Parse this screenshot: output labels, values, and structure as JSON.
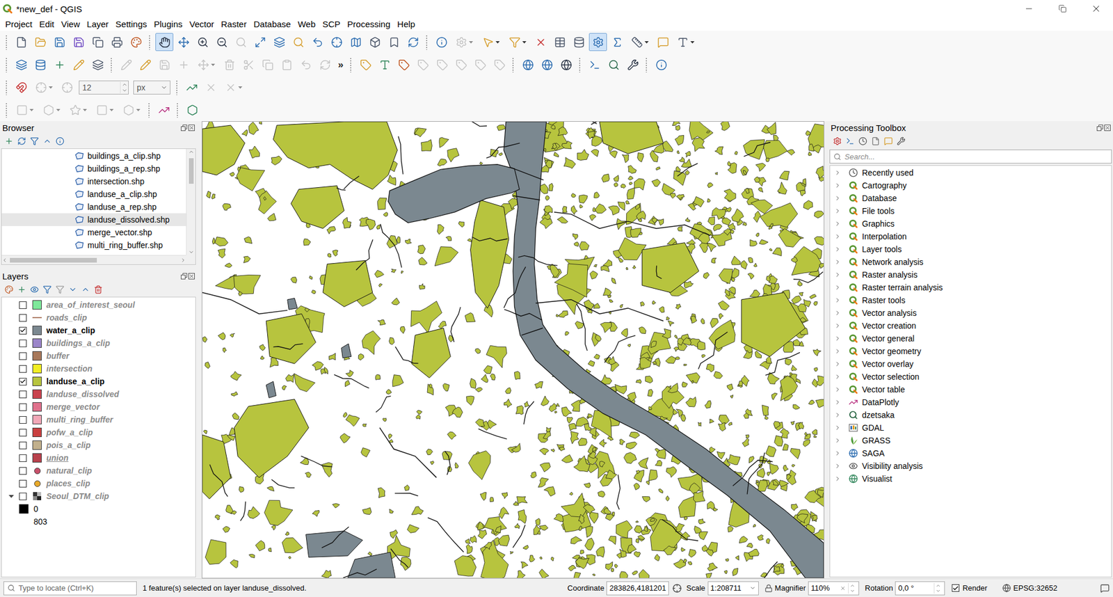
{
  "window": {
    "title": "*new_def - QGIS"
  },
  "menu": [
    "Project",
    "Edit",
    "View",
    "Layer",
    "Settings",
    "Plugins",
    "Vector",
    "Raster",
    "Database",
    "Web",
    "SCP",
    "Processing",
    "Help"
  ],
  "toolbars": [
    [
      {
        "kind": "button",
        "active": false,
        "disabled": false
      },
      {
        "kind": "button",
        "active": false,
        "disabled": false
      },
      {
        "kind": "button",
        "active": false,
        "disabled": false
      },
      {
        "kind": "button",
        "active": false,
        "disabled": false
      },
      {
        "kind": "button",
        "active": false,
        "disabled": false
      },
      {
        "kind": "button",
        "active": false,
        "disabled": false
      },
      {
        "kind": "button",
        "active": false,
        "disabled": false
      },
      {
        "kind": "separator"
      },
      {
        "kind": "button",
        "active": true,
        "disabled": false
      },
      {
        "kind": "button",
        "active": false,
        "disabled": false
      },
      {
        "kind": "button",
        "active": false,
        "disabled": false
      },
      {
        "kind": "button",
        "active": false,
        "disabled": false
      },
      {
        "kind": "button",
        "active": false,
        "disabled": true
      },
      {
        "kind": "button",
        "active": false,
        "disabled": false
      },
      {
        "kind": "button",
        "active": false,
        "disabled": false
      },
      {
        "kind": "button",
        "active": false,
        "disabled": false
      },
      {
        "kind": "button",
        "active": false,
        "disabled": false
      },
      {
        "kind": "button",
        "active": false,
        "disabled": false
      },
      {
        "kind": "button",
        "active": false,
        "disabled": false
      },
      {
        "kind": "button",
        "active": false,
        "disabled": false
      },
      {
        "kind": "button",
        "active": false,
        "disabled": false
      },
      {
        "kind": "button",
        "active": false,
        "disabled": false
      },
      {
        "kind": "separator"
      },
      {
        "kind": "button",
        "active": false,
        "disabled": false
      },
      {
        "kind": "menu-button",
        "active": false,
        "disabled": true
      },
      {
        "kind": "menu-button",
        "active": false,
        "disabled": false
      },
      {
        "kind": "menu-button",
        "active": false,
        "disabled": false
      },
      {
        "kind": "button",
        "active": false,
        "disabled": false
      },
      {
        "kind": "button",
        "active": false,
        "disabled": false
      },
      {
        "kind": "button",
        "active": false,
        "disabled": false
      },
      {
        "kind": "button",
        "active": true,
        "disabled": false
      },
      {
        "kind": "button",
        "active": false,
        "disabled": false
      },
      {
        "kind": "menu-button",
        "active": false,
        "disabled": false
      },
      {
        "kind": "button",
        "active": false,
        "disabled": false
      },
      {
        "kind": "menu-button",
        "active": false,
        "disabled": false
      }
    ],
    [
      {
        "kind": "button",
        "active": false,
        "disabled": false
      },
      {
        "kind": "button",
        "active": false,
        "disabled": false
      },
      {
        "kind": "button",
        "active": false,
        "disabled": false
      },
      {
        "kind": "button",
        "active": false,
        "disabled": false
      },
      {
        "kind": "button",
        "active": false,
        "disabled": false
      },
      {
        "kind": "separator"
      },
      {
        "kind": "button",
        "active": false,
        "disabled": true
      },
      {
        "kind": "button",
        "active": false,
        "disabled": false
      },
      {
        "kind": "button",
        "active": false,
        "disabled": true
      },
      {
        "kind": "button",
        "active": false,
        "disabled": true
      },
      {
        "kind": "menu-button",
        "active": false,
        "disabled": true
      },
      {
        "kind": "button",
        "active": false,
        "disabled": true
      },
      {
        "kind": "button",
        "active": false,
        "disabled": true
      },
      {
        "kind": "button",
        "active": false,
        "disabled": true
      },
      {
        "kind": "button",
        "active": false,
        "disabled": true
      },
      {
        "kind": "button",
        "active": false,
        "disabled": true
      },
      {
        "kind": "button",
        "active": false,
        "disabled": true
      },
      {
        "kind": "overflow",
        "label": "»"
      },
      {
        "kind": "separator"
      },
      {
        "kind": "button",
        "active": false,
        "disabled": false
      },
      {
        "kind": "button",
        "active": false,
        "disabled": false
      },
      {
        "kind": "button",
        "active": false,
        "disabled": false
      },
      {
        "kind": "button",
        "active": false,
        "disabled": true
      },
      {
        "kind": "button",
        "active": false,
        "disabled": true
      },
      {
        "kind": "button",
        "active": false,
        "disabled": true
      },
      {
        "kind": "button",
        "active": false,
        "disabled": true
      },
      {
        "kind": "button",
        "active": false,
        "disabled": true
      },
      {
        "kind": "separator"
      },
      {
        "kind": "button",
        "active": false,
        "disabled": false
      },
      {
        "kind": "button",
        "active": false,
        "disabled": false
      },
      {
        "kind": "button",
        "active": false,
        "disabled": false
      },
      {
        "kind": "separator"
      },
      {
        "kind": "button",
        "active": false,
        "disabled": false
      },
      {
        "kind": "button",
        "active": false,
        "disabled": false
      },
      {
        "kind": "button",
        "active": false,
        "disabled": false
      },
      {
        "kind": "separator"
      },
      {
        "kind": "button",
        "active": false,
        "disabled": false
      }
    ],
    [
      {
        "kind": "button",
        "active": false,
        "disabled": false
      },
      {
        "kind": "menu-button",
        "active": false,
        "disabled": true
      },
      {
        "kind": "button",
        "active": false,
        "disabled": true
      },
      {
        "kind": "spin",
        "value": "12"
      },
      {
        "kind": "dropdown",
        "value": "px"
      },
      {
        "kind": "separator"
      },
      {
        "kind": "button",
        "active": false,
        "disabled": false
      },
      {
        "kind": "button",
        "active": false,
        "disabled": true
      },
      {
        "kind": "menu-button",
        "active": false,
        "disabled": true
      }
    ],
    [
      {
        "kind": "menu-button",
        "active": false,
        "disabled": true
      },
      {
        "kind": "menu-button",
        "active": false,
        "disabled": true
      },
      {
        "kind": "menu-button",
        "active": false,
        "disabled": true
      },
      {
        "kind": "menu-button",
        "active": false,
        "disabled": true
      },
      {
        "kind": "menu-button",
        "active": false,
        "disabled": true
      },
      {
        "kind": "separator"
      },
      {
        "kind": "button",
        "active": false,
        "disabled": false
      },
      {
        "kind": "separator"
      },
      {
        "kind": "button",
        "active": false,
        "disabled": false
      }
    ]
  ],
  "browser": {
    "title": "Browser",
    "items": [
      {
        "label": "buildings_a_clip.shp",
        "selected": false
      },
      {
        "label": "buildings_a_rep.shp",
        "selected": false
      },
      {
        "label": "intersection.shp",
        "selected": false
      },
      {
        "label": "landuse_a_clip.shp",
        "selected": false
      },
      {
        "label": "landuse_a_rep.shp",
        "selected": false
      },
      {
        "label": "landuse_dissolved.shp",
        "selected": true
      },
      {
        "label": "merge_vector.shp",
        "selected": false
      },
      {
        "label": "multi_ring_buffer.shp",
        "selected": false
      }
    ]
  },
  "layers": {
    "title": "Layers",
    "items": [
      {
        "name": "area_of_interest_seoul",
        "checked": false,
        "kind": "fill",
        "color": "#7ee89a",
        "underlined": false
      },
      {
        "name": "roads_clip",
        "checked": false,
        "kind": "line",
        "color": "#b0806a",
        "underlined": false
      },
      {
        "name": "water_a_clip",
        "checked": true,
        "kind": "fill",
        "color": "#7b8890",
        "underlined": false
      },
      {
        "name": "buildings_a_clip",
        "checked": false,
        "kind": "fill",
        "color": "#9b85c9",
        "underlined": false
      },
      {
        "name": "buffer",
        "checked": false,
        "kind": "fill",
        "color": "#a8785a",
        "underlined": false
      },
      {
        "name": "intersection",
        "checked": false,
        "kind": "fill",
        "color": "#f2ee24",
        "underlined": false
      },
      {
        "name": "landuse_a_clip",
        "checked": true,
        "kind": "fill",
        "color": "#b7c43e",
        "underlined": false
      },
      {
        "name": "landuse_dissolved",
        "checked": false,
        "kind": "fill",
        "color": "#c9434e",
        "underlined": false
      },
      {
        "name": "merge_vector",
        "checked": false,
        "kind": "fill",
        "color": "#e0718c",
        "underlined": false
      },
      {
        "name": "multi_ring_buffer",
        "checked": false,
        "kind": "fill",
        "color": "#f2a7b7",
        "underlined": false
      },
      {
        "name": "pofw_a_clip",
        "checked": false,
        "kind": "fill",
        "color": "#c94040",
        "underlined": false
      },
      {
        "name": "pois_a_clip",
        "checked": false,
        "kind": "fill",
        "color": "#c2b08c",
        "underlined": false
      },
      {
        "name": "union",
        "checked": false,
        "kind": "fill",
        "color": "#b8414c",
        "underlined": true
      },
      {
        "name": "natural_clip",
        "checked": false,
        "kind": "point",
        "color": "#c8506a",
        "underlined": false
      },
      {
        "name": "places_clip",
        "checked": false,
        "kind": "point",
        "color": "#e8a92a",
        "underlined": false
      },
      {
        "name": "Seoul_DTM_clip",
        "checked": false,
        "kind": "raster",
        "color": "#808080",
        "underlined": false,
        "expanded": true,
        "legend": [
          {
            "label": "0",
            "color": "#000000"
          },
          {
            "label": "803",
            "color": "#ffffff"
          }
        ]
      }
    ]
  },
  "toolbox": {
    "title": "Processing Toolbox",
    "search": {
      "placeholder": "Search..."
    },
    "items": [
      {
        "label": "Recently used",
        "kind": "history",
        "expanded": false
      },
      {
        "label": "Cartography",
        "kind": "qgis",
        "expanded": false
      },
      {
        "label": "Database",
        "kind": "qgis",
        "expanded": false
      },
      {
        "label": "File tools",
        "kind": "qgis",
        "expanded": false
      },
      {
        "label": "Graphics",
        "kind": "qgis",
        "expanded": false
      },
      {
        "label": "Interpolation",
        "kind": "qgis",
        "expanded": false
      },
      {
        "label": "Layer tools",
        "kind": "qgis",
        "expanded": false
      },
      {
        "label": "Network analysis",
        "kind": "qgis",
        "expanded": false
      },
      {
        "label": "Raster analysis",
        "kind": "qgis",
        "expanded": false
      },
      {
        "label": "Raster terrain analysis",
        "kind": "qgis",
        "expanded": false
      },
      {
        "label": "Raster tools",
        "kind": "qgis",
        "expanded": false
      },
      {
        "label": "Vector analysis",
        "kind": "qgis",
        "expanded": false
      },
      {
        "label": "Vector creation",
        "kind": "qgis",
        "expanded": false
      },
      {
        "label": "Vector general",
        "kind": "qgis",
        "expanded": false
      },
      {
        "label": "Vector geometry",
        "kind": "qgis",
        "expanded": false
      },
      {
        "label": "Vector overlay",
        "kind": "qgis",
        "expanded": false
      },
      {
        "label": "Vector selection",
        "kind": "qgis",
        "expanded": false
      },
      {
        "label": "Vector table",
        "kind": "qgis",
        "expanded": false
      },
      {
        "label": "DataPlotly",
        "kind": "dataplotly",
        "expanded": false
      },
      {
        "label": "dzetsaka",
        "kind": "dzetsaka",
        "expanded": false
      },
      {
        "label": "GDAL",
        "kind": "gdal",
        "expanded": false
      },
      {
        "label": "GRASS",
        "kind": "grass",
        "expanded": false
      },
      {
        "label": "SAGA",
        "kind": "saga",
        "expanded": false
      },
      {
        "label": "Visibility analysis",
        "kind": "visibility",
        "expanded": false
      },
      {
        "label": "Visualist",
        "kind": "visualist",
        "expanded": false
      }
    ]
  },
  "status_bar": {
    "locator_placeholder": "Type to locate (Ctrl+K)",
    "message": "1 feature(s) selected on layer landuse_dissolved.",
    "coordinate_label": "Coordinate",
    "coordinate": "283826,4181201",
    "scale_label": "Scale",
    "scale": "1:208711",
    "magnifier_label": "Magnifier",
    "magnifier": "110%",
    "rotation_label": "Rotation",
    "rotation": "0,0 °",
    "render_label": "Render",
    "render": true,
    "crs": "EPSG:32652"
  }
}
